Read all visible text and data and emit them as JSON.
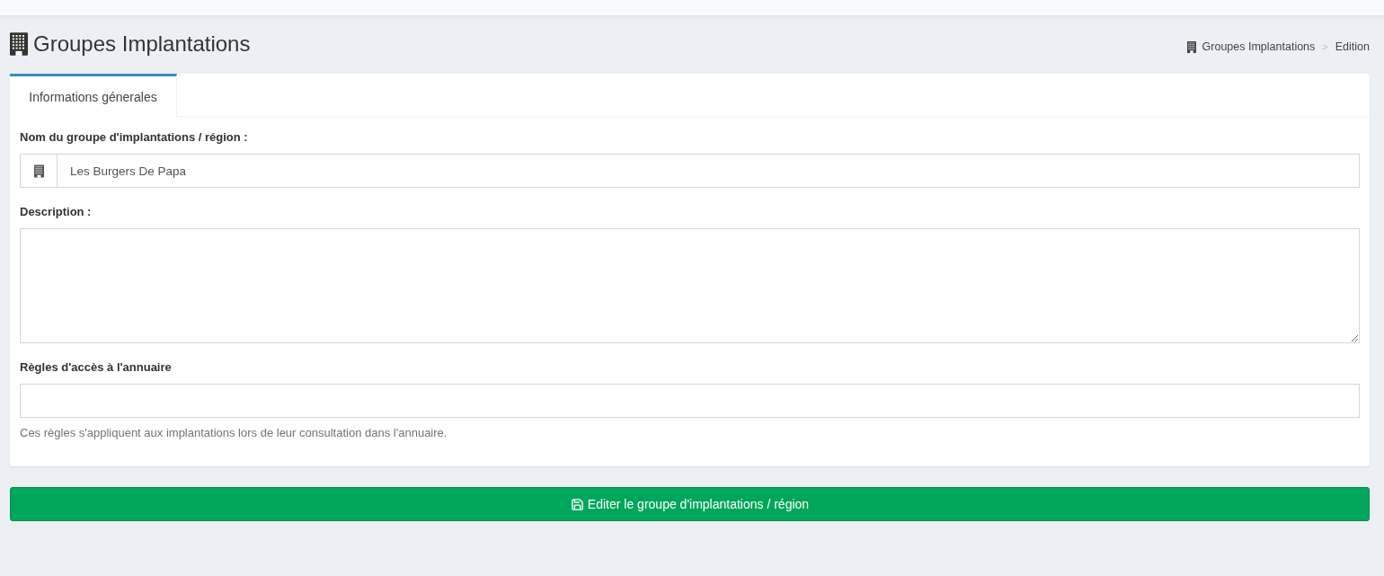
{
  "page": {
    "title": "Groupes Implantations"
  },
  "breadcrumb": {
    "separator": ">",
    "items": [
      {
        "label": "Groupes Implantations"
      },
      {
        "label": "Edition"
      }
    ]
  },
  "tabs": [
    {
      "label": "Informations génerales",
      "selected": true
    }
  ],
  "fields": [
    {
      "kind": "addon-input",
      "label": "Nom du groupe d'implantations / région :",
      "value": "Les Burgers De Papa"
    },
    {
      "kind": "textarea",
      "label": "Description :"
    },
    {
      "kind": "input",
      "label": "Règles d'accès à l'annuaire",
      "help": "Ces règles s'appliquent aux implantations lors de leur consultation dans l'annuaire."
    }
  ],
  "submit_button": {
    "label": "Editer le groupe d'implantations / région"
  }
}
